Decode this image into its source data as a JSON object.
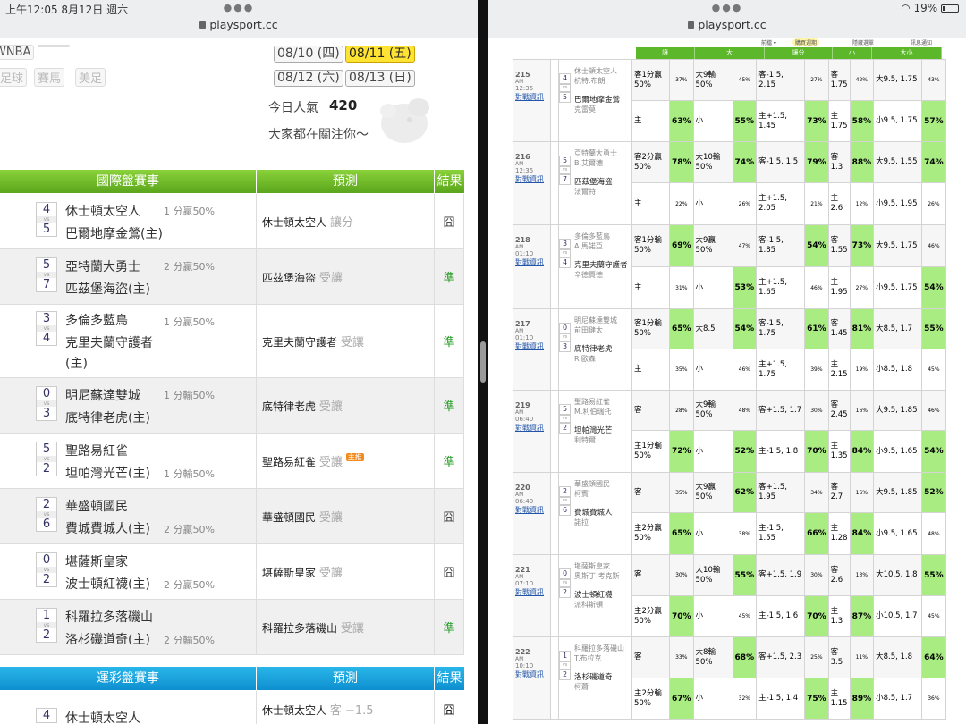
{
  "left": {
    "clock": "上午12:05  8月12日 週六",
    "url": "playsport.cc",
    "chips": [
      "WNBA",
      "足球",
      "賽馬",
      "美足"
    ],
    "dates": [
      "08/10 (四)",
      "08/11 (五)",
      "08/12 (六)",
      "08/13 (日)"
    ],
    "pop_label": "今日人氣",
    "pop_value": "420",
    "pop_sub": "大家都在關注你～",
    "g1": {
      "title": "國際盤賽事",
      "pred": "預測",
      "result": "結果"
    },
    "g2": {
      "title": "運彩盤賽事",
      "pred": "預測",
      "result": "結果"
    },
    "badge": "主推",
    "games": [
      {
        "s1": "4",
        "s2": "5",
        "t1": "休士頓太空人",
        "t2": "巴爾地摩金鶯(主)",
        "h": "1 分贏50%",
        "hrow": 1,
        "pick": "休士頓太空人",
        "ptype": "讓分",
        "res": "囧",
        "hot": false
      },
      {
        "s1": "5",
        "s2": "7",
        "t1": "亞特蘭大勇士",
        "t2": "匹茲堡海盜(主)",
        "h": "2 分贏50%",
        "hrow": 1,
        "pick": "匹茲堡海盜",
        "ptype": "受讓",
        "res": "準",
        "hot": false
      },
      {
        "s1": "3",
        "s2": "4",
        "t1": "多倫多藍鳥",
        "t2": "克里夫蘭守護者",
        "t3": "(主)",
        "h": "1 分贏50%",
        "hrow": 1,
        "pick": "克里夫蘭守護者",
        "ptype": "受讓",
        "res": "準",
        "hot": false
      },
      {
        "s1": "0",
        "s2": "3",
        "t1": "明尼蘇達雙城",
        "t2": "底特律老虎(主)",
        "h": "1 分輸50%",
        "hrow": 1,
        "pick": "底特律老虎",
        "ptype": "受讓",
        "res": "準",
        "hot": false
      },
      {
        "s1": "5",
        "s2": "2",
        "t1": "聖路易紅雀",
        "t2": "坦帕灣光芒(主)",
        "h": "1 分輸50%",
        "hrow": 2,
        "pick": "聖路易紅雀",
        "ptype": "受讓",
        "res": "準",
        "hot": true
      },
      {
        "s1": "2",
        "s2": "6",
        "t1": "華盛頓國民",
        "t2": "費城費城人(主)",
        "h": "2 分贏50%",
        "hrow": 2,
        "pick": "華盛頓國民",
        "ptype": "受讓",
        "res": "囧",
        "hot": false
      },
      {
        "s1": "0",
        "s2": "2",
        "t1": "堪薩斯皇家",
        "t2": "波士頓紅襪(主)",
        "h": "2 分贏50%",
        "hrow": 2,
        "pick": "堪薩斯皇家",
        "ptype": "受讓",
        "res": "囧",
        "hot": false
      },
      {
        "s1": "1",
        "s2": "2",
        "t1": "科羅拉多落磯山",
        "t2": "洛杉磯道奇(主)",
        "h": "2 分輸50%",
        "hrow": 2,
        "pick": "科羅拉多落磯山",
        "ptype": "受讓",
        "res": "準",
        "hot": false
      }
    ],
    "last": {
      "s1": "4",
      "t1": "休士頓太空人",
      "pick": "休士頓太空人",
      "ptype": "客 −1.5",
      "res": "囧"
    }
  },
  "right": {
    "url": "playsport.cc",
    "status": "19%",
    "tabs": [
      "前檔 ▾",
      "購買週期",
      "隱藏選單",
      "訊息通知"
    ],
    "heads": [
      "讓",
      "大",
      "讓分",
      "小",
      "大小"
    ],
    "link": "對戰資訊",
    "games": [
      {
        "no": "215",
        "ap": "AM",
        "time": "12:35",
        "s1": "4",
        "s2": "5",
        "t1": "休士頓太空人",
        "p1": "杭特.布朗",
        "t2": "巴爾地摩金鶯",
        "p2": "克雷莫",
        "r1": [
          "客1分贏50%",
          "37%",
          "大9輸50%",
          "45%",
          "客-1.5, 2.15",
          "27%",
          "客 1.75",
          "42%",
          "大9.5, 1.75",
          "43%"
        ],
        "r2": [
          "主",
          "63%",
          "小",
          "55%",
          "主+1.5, 1.45",
          "73%",
          "主 1.75",
          "58%",
          "小9.5, 1.75",
          "57%"
        ],
        "g1": [],
        "g2": [
          1,
          3,
          5,
          7,
          9
        ]
      },
      {
        "no": "216",
        "ap": "AM",
        "time": "12:35",
        "s1": "5",
        "s2": "7",
        "t1": "亞特蘭大勇士",
        "p1": "B.艾爾德",
        "t2": "匹茲堡海盜",
        "p2": "法爾特",
        "r1": [
          "客2分贏50%",
          "78%",
          "大10輸50%",
          "74%",
          "客-1.5, 1.5",
          "79%",
          "客1.3",
          "88%",
          "大9.5, 1.55",
          "74%"
        ],
        "r2": [
          "主",
          "22%",
          "小",
          "26%",
          "主+1.5, 2.05",
          "21%",
          "主2.6",
          "12%",
          "小9.5, 1.95",
          "26%"
        ],
        "g1": [
          1,
          3,
          5,
          7,
          9
        ],
        "g2": []
      },
      {
        "no": "218",
        "ap": "AM",
        "time": "01:10",
        "s1": "3",
        "s2": "4",
        "t1": "多倫多藍鳥",
        "p1": "A.馬諾亞",
        "t2": "克里夫蘭守護者",
        "p2": "辛德賈德",
        "r1": [
          "客1分輸50%",
          "69%",
          "大9贏50%",
          "47%",
          "客-1.5, 1.85",
          "54%",
          "客 1.55",
          "73%",
          "大9.5, 1.75",
          "46%"
        ],
        "r2": [
          "主",
          "31%",
          "小",
          "53%",
          "主+1.5, 1.65",
          "46%",
          "主 1.95",
          "27%",
          "小9.5, 1.75",
          "54%"
        ],
        "g1": [
          1,
          5,
          7
        ],
        "g2": [
          3,
          9
        ]
      },
      {
        "no": "217",
        "ap": "AM",
        "time": "01:10",
        "s1": "0",
        "s2": "3",
        "t1": "明尼蘇達雙城",
        "p1": "前田健太",
        "t2": "底特律老虎",
        "p2": "R.歐森",
        "r1": [
          "客1分輸50%",
          "65%",
          "大8.5",
          "54%",
          "客-1.5, 1.75",
          "61%",
          "客 1.45",
          "81%",
          "大8.5, 1.7",
          "55%"
        ],
        "r2": [
          "主",
          "35%",
          "小",
          "46%",
          "主+1.5, 1.75",
          "39%",
          "主 2.15",
          "19%",
          "小8.5, 1.8",
          "45%"
        ],
        "g1": [
          1,
          3,
          5,
          7,
          9
        ],
        "g2": []
      },
      {
        "no": "219",
        "ap": "AM",
        "time": "06:40",
        "s1": "5",
        "s2": "2",
        "t1": "聖路易紅雀",
        "p1": "M.利伯瑞托",
        "t2": "坦帕灣光芒",
        "p2": "利特爾",
        "r1": [
          "客",
          "28%",
          "大9輸50%",
          "48%",
          "客+1.5, 1.7",
          "30%",
          "客 2.45",
          "16%",
          "大9.5, 1.85",
          "46%"
        ],
        "r2": [
          "主1分輸50%",
          "72%",
          "小",
          "52%",
          "主-1.5, 1.8",
          "70%",
          "主 1.35",
          "84%",
          "小9.5, 1.65",
          "54%"
        ],
        "g1": [],
        "g2": [
          1,
          3,
          5,
          7,
          9
        ]
      },
      {
        "no": "220",
        "ap": "AM",
        "time": "06:40",
        "s1": "2",
        "s2": "6",
        "t1": "華盛頓國民",
        "p1": "柯賓",
        "t2": "費城費城人",
        "p2": "諾拉",
        "r1": [
          "客",
          "35%",
          "大9贏50%",
          "62%",
          "客+1.5, 1.95",
          "34%",
          "客2.7",
          "16%",
          "大9.5, 1.85",
          "52%"
        ],
        "r2": [
          "主2分贏50%",
          "65%",
          "小",
          "38%",
          "主-1.5, 1.55",
          "66%",
          "主 1.28",
          "84%",
          "小9.5, 1.65",
          "48%"
        ],
        "g1": [
          3,
          9
        ],
        "g2": [
          1,
          5,
          7
        ]
      },
      {
        "no": "221",
        "ap": "AM",
        "time": "07:10",
        "s1": "0",
        "s2": "2",
        "t1": "堪薩斯皇家",
        "p1": "奧斯丁.考克斯",
        "t2": "波士頓紅襪",
        "p2": "派科斯頓",
        "r1": [
          "客",
          "30%",
          "大10輸50%",
          "55%",
          "客+1.5, 1.9",
          "30%",
          "客2.6",
          "13%",
          "大10.5, 1.8",
          "55%"
        ],
        "r2": [
          "主2分贏50%",
          "70%",
          "小",
          "45%",
          "主-1.5, 1.6",
          "70%",
          "主1.3",
          "87%",
          "小10.5, 1.7",
          "45%"
        ],
        "g1": [
          3,
          9
        ],
        "g2": [
          1,
          5,
          7
        ]
      },
      {
        "no": "222",
        "ap": "AM",
        "time": "10:10",
        "s1": "1",
        "s2": "2",
        "t1": "科羅拉多落磯山",
        "p1": "T.布拉克",
        "t2": "洛杉磯道奇",
        "p2": "柯蕭",
        "r1": [
          "客",
          "33%",
          "大8輸50%",
          "68%",
          "客+1.5, 2.3",
          "25%",
          "客3.5",
          "11%",
          "大8.5, 1.8",
          "64%"
        ],
        "r2": [
          "主2分輸50%",
          "67%",
          "小",
          "32%",
          "主-1.5, 1.4",
          "75%",
          "主 1.15",
          "89%",
          "小8.5, 1.7",
          "36%"
        ],
        "g1": [
          3,
          9
        ],
        "g2": [
          1,
          5,
          7
        ]
      }
    ]
  }
}
